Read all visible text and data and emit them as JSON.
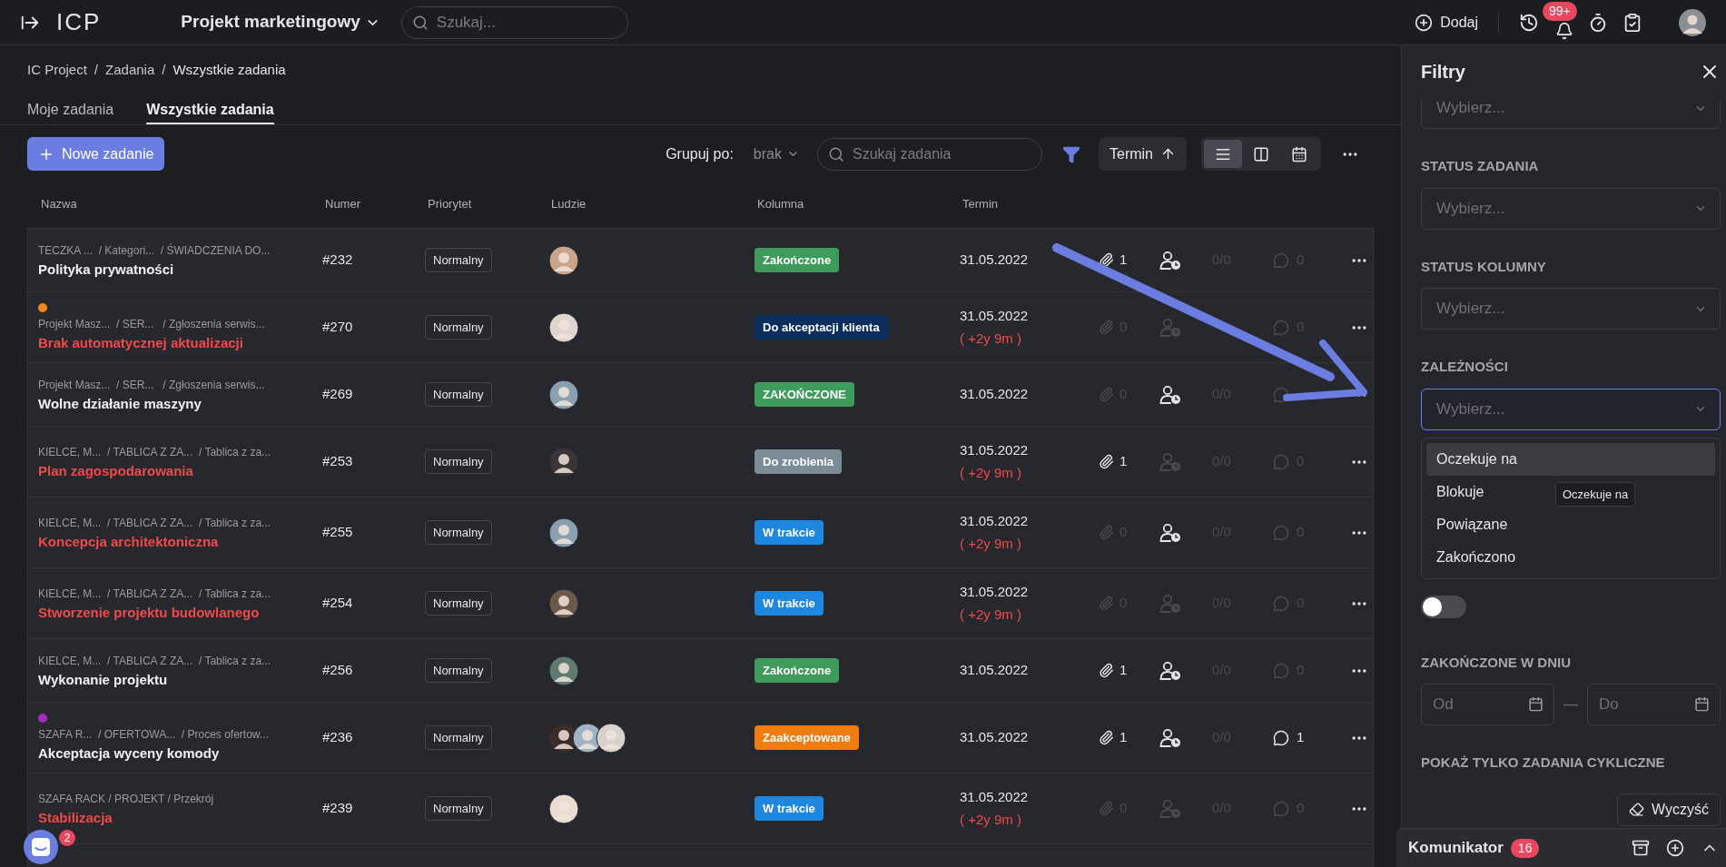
{
  "top_bar": {
    "logo": "ICP",
    "project": "Projekt marketingowy",
    "search_placeholder": "Szukaj...",
    "add_label": "Dodaj",
    "notifications_badge": "99+"
  },
  "breadcrumbs": {
    "separator": "/",
    "items": [
      "IC Project",
      "Zadania",
      "Wszystkie zadania"
    ]
  },
  "tabs": [
    {
      "label": "Moje zadania",
      "selected": false
    },
    {
      "label": "Wszystkie zadania",
      "selected": true
    }
  ],
  "toolbar": {
    "new_task": "Nowe zadanie",
    "group_label": "Grupuj po:",
    "group_value": "brak",
    "search_placeholder": "Szukaj zadania",
    "filter_active": true,
    "sort": {
      "label": "Termin",
      "ascending": true
    },
    "views": [
      {
        "kind": "list",
        "selected": true
      },
      {
        "kind": "board",
        "selected": false
      },
      {
        "kind": "calendar",
        "selected": false
      }
    ]
  },
  "table": {
    "columns": [
      "Nazwa",
      "Numer",
      "Priorytet",
      "Ludzie",
      "Kolumna",
      "Termin"
    ],
    "rows": [
      {
        "path": "TECZKA ...  / Kategori...  / ŚWIADCZENIA DO...",
        "name": "Polityka prywatności",
        "late": false,
        "number": "#232",
        "priority": "Normalny",
        "people": [
          {
            "color": "#c9a48a"
          }
        ],
        "status": {
          "label": "Zakończone",
          "color": "#3f9b5c"
        },
        "date": "31.05.2022",
        "attachments": {
          "count": "1",
          "active": true
        },
        "assignee": {
          "active": true
        },
        "subtasks": "0/0",
        "comments": {
          "count": "0",
          "active": false
        }
      },
      {
        "marker": {
          "color": "#f08a1c"
        },
        "path": "Projekt Masz...  / SER...   / Zgłoszenia serwis...",
        "name": "Brak automatycznej aktualizacji",
        "late": true,
        "number": "#270",
        "priority": "Normalny",
        "people": [
          {
            "color": "#e0d6d0"
          }
        ],
        "status": {
          "label": "Do akceptacji klienta",
          "color": "#0c2e5e"
        },
        "date": "31.05.2022",
        "delay": "( +2y 9m )",
        "attachments": {
          "count": "0",
          "active": false
        },
        "assignee": {
          "active": false
        },
        "comments": {
          "count": "0",
          "active": false
        }
      },
      {
        "path": "Projekt Masz...  / SER...   / Zgłoszenia serwis...",
        "name": "Wolne działanie maszyny",
        "late": false,
        "number": "#269",
        "priority": "Normalny",
        "people": [
          {
            "color": "#8aa0b0"
          }
        ],
        "status": {
          "label": "ZAKOŃCZONE",
          "color": "#3f9b5c"
        },
        "date": "31.05.2022",
        "attachments": {
          "count": "0",
          "active": false
        },
        "assignee": {
          "active": true
        },
        "subtasks": "0/0",
        "comments": {
          "active": false
        }
      },
      {
        "path": "KIELCE, M...  / TABLICA Z ZA...  / Tablica z za...",
        "name": "Plan zagospodarowania",
        "late": true,
        "number": "#253",
        "priority": "Normalny",
        "people": [
          {
            "color": "#3a3536"
          }
        ],
        "status": {
          "label": "Do zrobienia",
          "color": "#7b8c97"
        },
        "date": "31.05.2022",
        "delay": "( +2y 9m )",
        "attachments": {
          "count": "1",
          "active": true
        },
        "assignee": {
          "active": false
        },
        "subtasks": "0/0",
        "comments": {
          "count": "0",
          "active": false
        }
      },
      {
        "path": "KIELCE, M...  / TABLICA Z ZA...  / Tablica z za...",
        "name": "Koncepcja architektoniczna",
        "late": true,
        "number": "#255",
        "priority": "Normalny",
        "people": [
          {
            "color": "#8aa0b0"
          }
        ],
        "status": {
          "label": "W trakcie",
          "color": "#1e88e0"
        },
        "date": "31.05.2022",
        "delay": "( +2y 9m )",
        "attachments": {
          "count": "0",
          "active": false
        },
        "assignee": {
          "active": true
        },
        "subtasks": "0/0",
        "comments": {
          "count": "0",
          "active": false
        }
      },
      {
        "path": "KIELCE, M...  / TABLICA Z ZA...  / Tablica z za...",
        "name": "Stworzenie projektu budowlanego",
        "late": true,
        "number": "#254",
        "priority": "Normalny",
        "people": [
          {
            "color": "#6b5a4a"
          }
        ],
        "status": {
          "label": "W trakcie",
          "color": "#1e88e0"
        },
        "date": "31.05.2022",
        "delay": "( +2y 9m )",
        "attachments": {
          "count": "0",
          "active": false
        },
        "assignee": {
          "active": false
        },
        "subtasks": "0/0",
        "comments": {
          "count": "0",
          "active": false
        }
      },
      {
        "path": "KIELCE, M...  / TABLICA Z ZA...  / Tablica z za...",
        "name": "Wykonanie projektu",
        "late": false,
        "number": "#256",
        "priority": "Normalny",
        "people": [
          {
            "color": "#5f7a70"
          }
        ],
        "status": {
          "label": "Zakończone",
          "color": "#3f9b5c"
        },
        "date": "31.05.2022",
        "attachments": {
          "count": "1",
          "active": true
        },
        "assignee": {
          "active": true
        },
        "subtasks": "0/0",
        "comments": {
          "count": "0",
          "active": false
        }
      },
      {
        "marker": {
          "color": "#a52bbf"
        },
        "path": "SZAFA R...  / OFERTOWA...  / Proces ofertow...",
        "name": "Akceptacja wyceny komody",
        "late": false,
        "number": "#236",
        "priority": "Normalny",
        "people": [
          {
            "color": "#3b2c28"
          },
          {
            "color": "#9fb3c4"
          },
          {
            "color": "#d8d2cc"
          }
        ],
        "status": {
          "label": "Zaakceptowane",
          "color": "#f07d14"
        },
        "date": "31.05.2022",
        "attachments": {
          "count": "1",
          "active": true
        },
        "assignee": {
          "active": true
        },
        "subtasks": "0/0",
        "comments": {
          "count": "1",
          "active": true
        }
      },
      {
        "path": "SZAFA RACK / PROJEKT / Przekrój",
        "name": "Stabilizacja",
        "late": true,
        "number": "#239",
        "priority": "Normalny",
        "people": [
          {
            "color": "#eadcd2"
          }
        ],
        "status": {
          "label": "W trakcie",
          "color": "#1e88e0"
        },
        "date": "31.05.2022",
        "delay": "( +2y 9m )",
        "attachments": {
          "count": "0",
          "active": false
        },
        "assignee": {
          "active": false
        },
        "subtasks": "0/0",
        "comments": {
          "count": "0",
          "active": false
        }
      }
    ]
  },
  "filter_panel": {
    "title": "Filtry",
    "top_select": {
      "placeholder": "Wybierz..."
    },
    "sections": [
      {
        "label": "STATUS ZADANIA",
        "placeholder": "Wybierz...",
        "open": false
      },
      {
        "label": "STATUS KOLUMNY",
        "placeholder": "Wybierz...",
        "open": false
      },
      {
        "label": "ZALEŻNOŚCI",
        "placeholder": "Wybierz...",
        "open": true,
        "options": [
          {
            "label": "Oczekuje na",
            "selected": true
          },
          {
            "label": "Blokuje",
            "selected": false
          },
          {
            "label": "Powiązane",
            "selected": false
          },
          {
            "label": "Zakończono",
            "selected": false
          }
        ],
        "tooltip": "Oczekuje na"
      }
    ],
    "toggle": {
      "on": false
    },
    "date_range": {
      "label": "ZAKOŃCZONE W DNIU",
      "from_placeholder": "Od",
      "separator": "—",
      "to_placeholder": "Do"
    },
    "cyclic_label": "POKAŻ TYLKO ZADANIA CYKLICZNE",
    "clear_button": "Wyczyść"
  },
  "messenger": {
    "title": "Komunikator",
    "count": "16"
  },
  "chat_widget": {
    "badge": "2"
  }
}
